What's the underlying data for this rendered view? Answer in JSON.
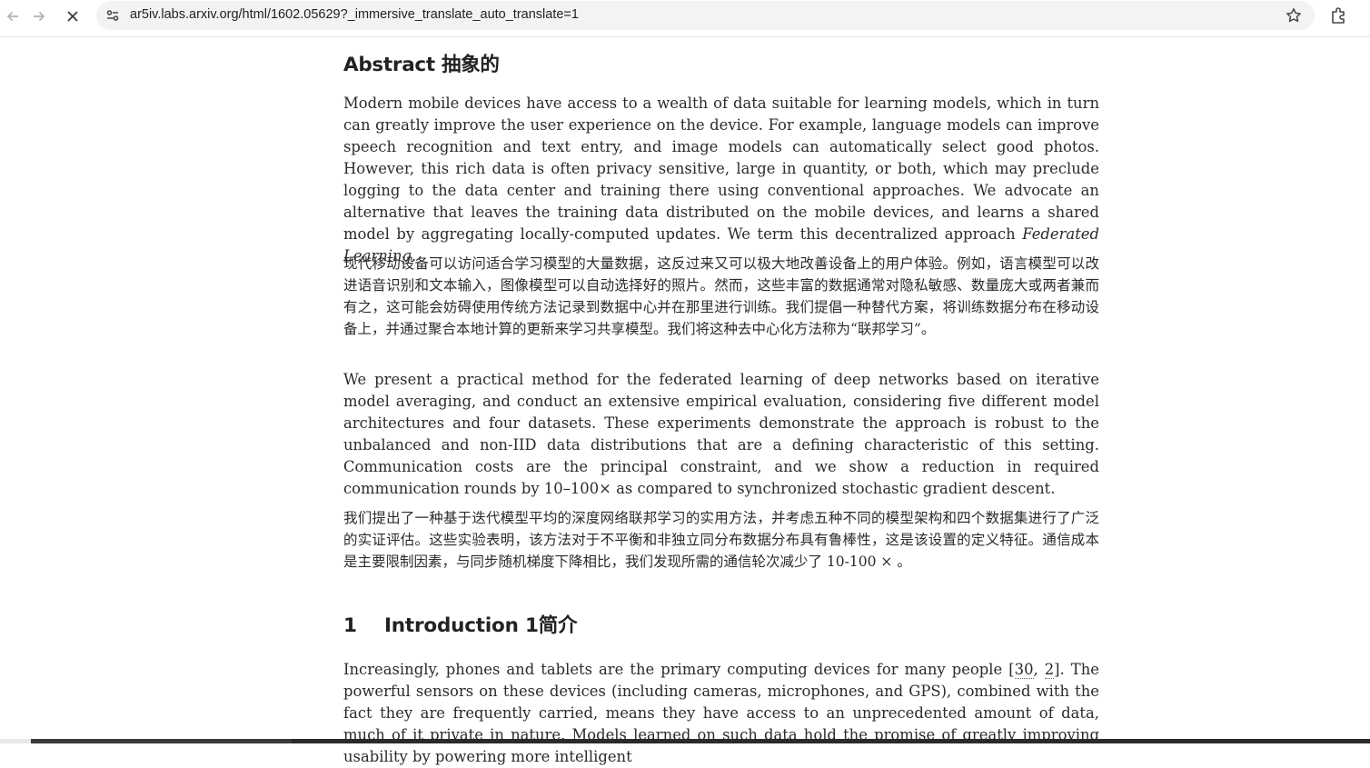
{
  "browser": {
    "url": "ar5iv.labs.arxiv.org/html/1602.05629?_immersive_translate_auto_translate=1",
    "icons": [
      "back-icon",
      "forward-icon",
      "stop-loading-icon",
      "site-settings-icon",
      "bookmark-star-icon",
      "extensions-icon"
    ]
  },
  "abstract": {
    "heading": "Abstract 抽象的",
    "para1_before_em": "Modern mobile devices have access to a wealth of data suitable for learning models, which in turn can greatly improve the user experience on the device. For example, language models can improve speech recog­nition and text entry, and image models can automatically select good photos. However, this rich data is often privacy sensitive, large in quantity, or both, which may preclude logging to the data center and training there using conventional approaches. We advocate an alternative that leaves the training data distributed on the mobile devices, and learns a shared model by aggregating locally-computed updates. We term this decentral­ized approach ",
    "para1_em": "Federated Learning",
    "para1_after_em": ".",
    "para1_zh": "现代移动设备可以访问适合学习模型的大量数据，这反过来又可以极大地改善设备上的用户体验。例如，语言模型可以改进语音识别和文本输入，图像模型可以自动选择好的照片。然而，这些丰富的数据通常对隐私敏感、数量庞大或两者兼而有之，这可能会妨碍使用传统方法记录到数据中心并在那里进行训练。我们提倡一种替代方案，将训练数据分布在移动设备上，并通过聚合本地计算的更新来学习共享模型。我们将这种去中心化方法称为“联邦学习”。",
    "para2": "We present a practical method for the federated learning of deep networks based on iterative model averag­ing, and conduct an extensive empirical evaluation, considering five different model architectures and four datasets. These experiments demonstrate the approach is robust to the unbalanced and non-IID data distri­butions that are a defining characteristic of this setting. Communication costs are the principal constraint, and we show a reduction in required communication rounds by 10–100× as compared to synchronized sto­chastic gradient descent.",
    "para2_zh": "我们提出了一种基于迭代模型平均的深度网络联邦学习的实用方法，并考虑五种不同的模型架构和四个数据集进行了广泛的实证评估。这些实验表明，该方法对于不平衡和非独立同分布数据分布具有鲁棒性，这是该设置的定义特征。通信成本是主要限制因素，与同步随机梯度下降相比，我们发现所需的通信轮次减少了 10-100 × 。"
  },
  "introduction": {
    "number": "1",
    "heading": "Introduction 1简介",
    "para1_a": "Increasingly, phones and tablets are the primary computing devices for many people [",
    "cite1": "30",
    "cite_sep": ", ",
    "cite2": "2",
    "para1_b": "]. The powerful sensors on these devices (including cameras, microphones, and GPS), combined with the fact they are fre­quently carried, means they have access to an unprecedented amount of data, much of it private in nature. Models learned on such data hold the promise of greatly improving usability by powering more intelligent"
  }
}
